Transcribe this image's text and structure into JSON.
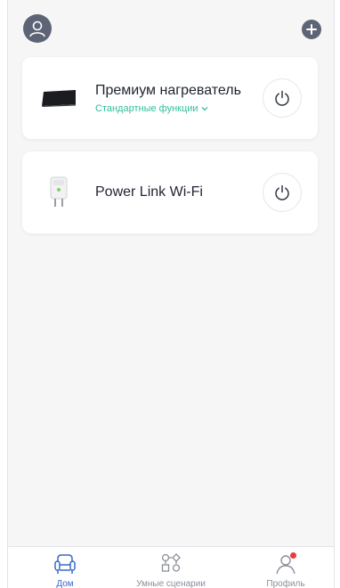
{
  "header": {
    "avatar_icon": "user-avatar-icon",
    "add_icon": "plus-icon"
  },
  "devices": [
    {
      "name": "Премиум нагреватель",
      "function_label": "Стандартные функции",
      "image": "heater-device-image",
      "power_icon": "power-icon"
    },
    {
      "name": "Power Link Wi-Fi",
      "image": "smart-plug-device-image",
      "power_icon": "power-icon"
    }
  ],
  "tabbar": {
    "items": [
      {
        "label": "Дом",
        "icon": "home-sofa-icon",
        "active": true
      },
      {
        "label": "Умные сценарии",
        "icon": "scenes-icon",
        "active": false
      },
      {
        "label": "Профиль",
        "icon": "profile-icon",
        "active": false
      }
    ]
  },
  "colors": {
    "accent_green": "#2fbf9b",
    "accent_blue": "#3a68c8",
    "header_icon": "#5d6475",
    "notification": "#e83b3b"
  }
}
